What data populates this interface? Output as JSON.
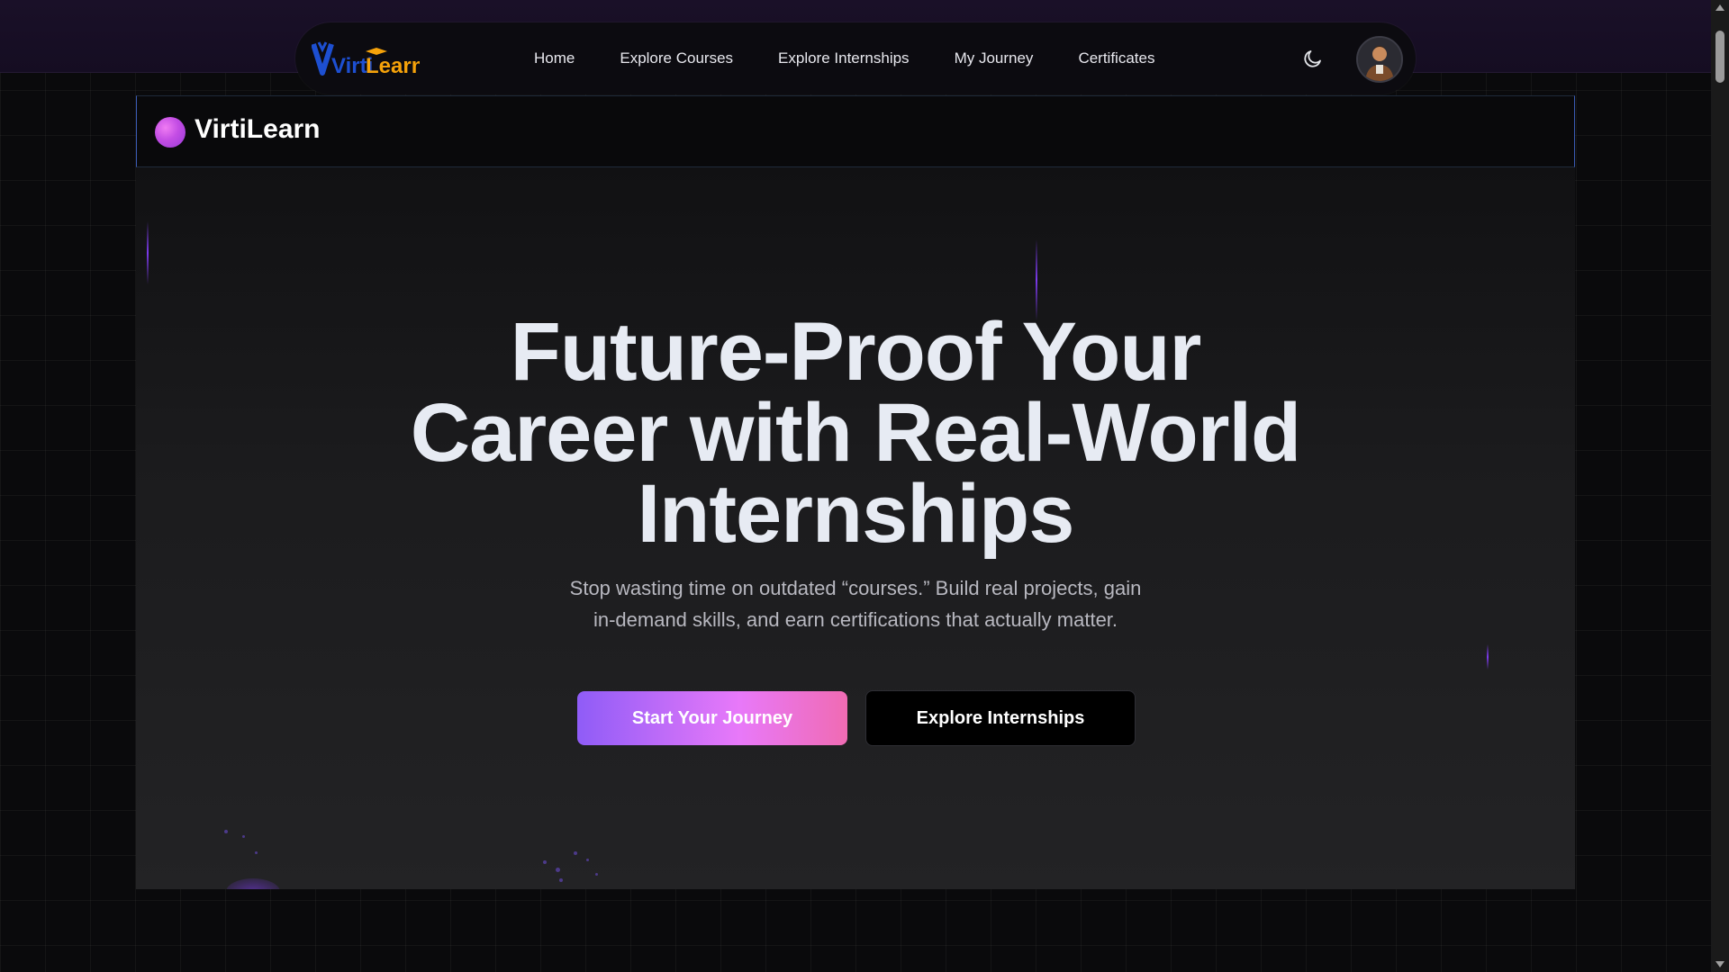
{
  "nav": {
    "logo_text_a": "Virti",
    "logo_text_b": "Learn",
    "links": [
      "Home",
      "Explore Courses",
      "Explore Internships",
      "My Journey",
      "Certificates"
    ]
  },
  "icons": {
    "theme_toggle": "moon-icon",
    "avatar": "user-avatar"
  },
  "header_card": {
    "brand": "VirtiLearn"
  },
  "hero": {
    "title_line1": "Future-Proof Your",
    "title_line2": "Career with Real-World",
    "title_line3": "Internships",
    "subtitle_line1": "Stop wasting time on outdated “courses.” Build real projects, gain",
    "subtitle_line2": "in-demand skills, and earn certifications that actually matter.",
    "primary_cta": "Start Your Journey",
    "secondary_cta": "Explore Internships"
  },
  "colors": {
    "accent_purple": "#8f5cf7",
    "accent_pink": "#f06bb3",
    "logo_blue": "#1d4fd1",
    "logo_orange": "#f5a20a"
  }
}
